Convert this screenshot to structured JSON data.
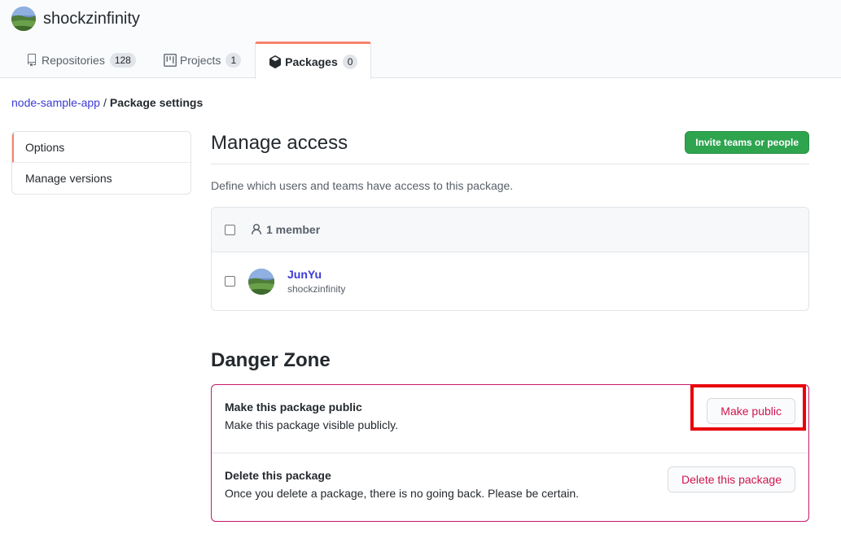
{
  "header": {
    "owner_name": "shockzinfinity",
    "tabs": [
      {
        "label": "Repositories",
        "count": "128",
        "icon": "repo-icon"
      },
      {
        "label": "Projects",
        "count": "1",
        "icon": "project-icon"
      },
      {
        "label": "Packages",
        "count": "0",
        "icon": "package-icon"
      }
    ],
    "selected_tab": "Packages"
  },
  "breadcrumb": {
    "package_link": "node-sample-app",
    "separator": "/",
    "current": "Package settings"
  },
  "side_menu": {
    "items": [
      {
        "label": "Options",
        "selected": true
      },
      {
        "label": "Manage versions",
        "selected": false
      }
    ]
  },
  "manage_access": {
    "title": "Manage access",
    "invite_button": "Invite teams or people",
    "description": "Define which users and teams have access to this package.",
    "member_count": "1 member",
    "members": [
      {
        "name": "JunYu",
        "login": "shockzinfinity"
      }
    ]
  },
  "danger_zone": {
    "title": "Danger Zone",
    "rows": [
      {
        "title": "Make this package public",
        "description": "Make this package visible publicly.",
        "button": "Make public"
      },
      {
        "title": "Delete this package",
        "description": "Once you delete a package, there is no going back. Please be certain.",
        "button": "Delete this package"
      }
    ]
  },
  "colors": {
    "accent_tab": "#f9826c",
    "primary_button": "#2ea44f",
    "danger": "#d0154e",
    "link": "#3b3bd6",
    "highlight_box": "#e8000b"
  }
}
